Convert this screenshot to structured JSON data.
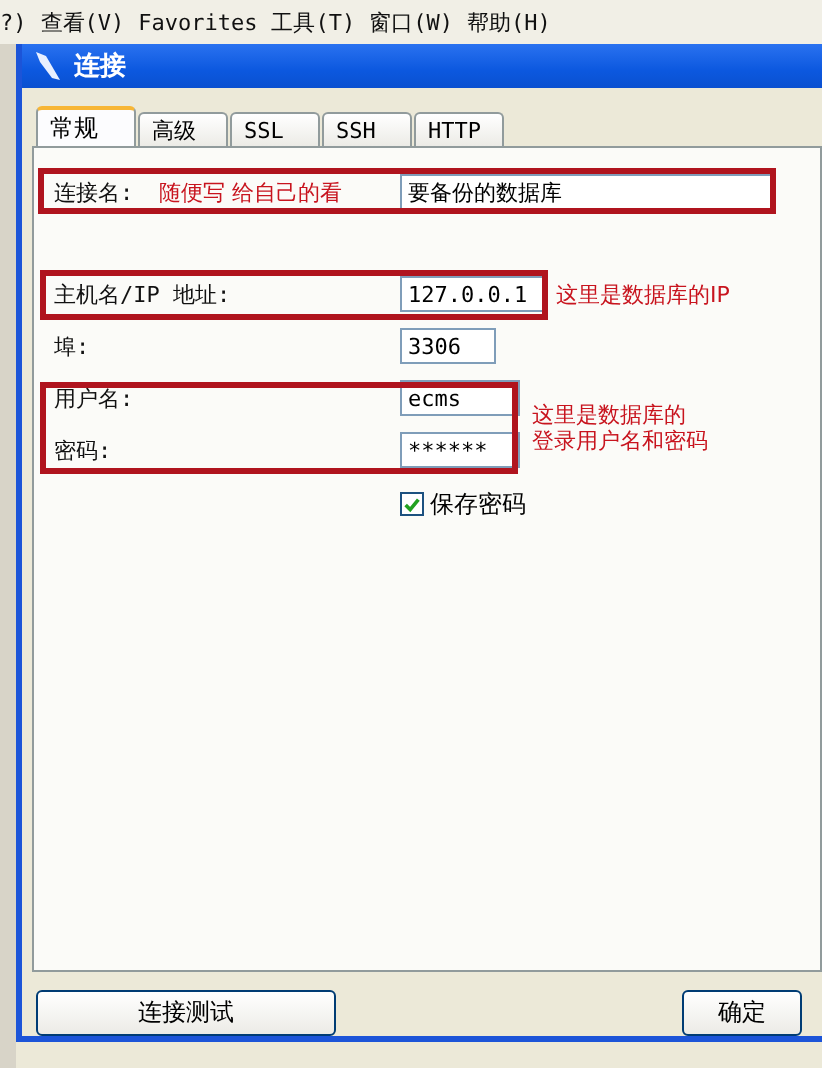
{
  "menu_bar": {
    "items": [
      "?)",
      "查看(V)",
      "Favorites",
      "工具(T)",
      "窗口(W)",
      "帮助(H)"
    ]
  },
  "dialog": {
    "title": "连接"
  },
  "tabs": [
    {
      "label": "常规",
      "selected": true
    },
    {
      "label": "高级",
      "selected": false
    },
    {
      "label": "SSL",
      "selected": false
    },
    {
      "label": "SSH",
      "selected": false
    },
    {
      "label": "HTTP",
      "selected": false
    }
  ],
  "fields": [
    {
      "label": "连接名:",
      "value": "要备份的数据库",
      "note": "随便写 给自己的看"
    },
    {
      "label": "主机名/IP 地址:",
      "value": "127.0.0.1",
      "note": "这里是数据库的IP"
    },
    {
      "label": "埠:",
      "value": "3306"
    },
    {
      "label": "用户名:",
      "value": "ecms"
    },
    {
      "label": "密码:",
      "value": "******"
    }
  ],
  "login_note": [
    "这里是数据库的",
    "登录用户名和密码"
  ],
  "save_password": {
    "label": "保存密码",
    "checked": true
  },
  "buttons": [
    {
      "label": "连接测试"
    },
    {
      "label": "确定"
    }
  ]
}
